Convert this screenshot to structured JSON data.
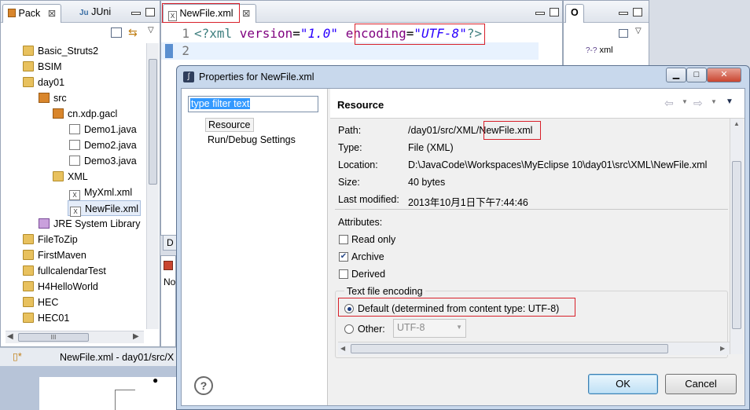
{
  "package_explorer": {
    "tabs": [
      {
        "label": "Pack"
      },
      {
        "label": "JUni"
      }
    ],
    "tree": [
      {
        "label": "Basic_Struts2",
        "icon": "project"
      },
      {
        "label": "BSIM",
        "icon": "project"
      },
      {
        "label": "day01",
        "icon": "project"
      },
      {
        "label": "src",
        "icon": "source-folder"
      },
      {
        "label": "cn.xdp.gacl",
        "icon": "package"
      },
      {
        "label": "Demo1.java",
        "icon": "java-file"
      },
      {
        "label": "Demo2.java",
        "icon": "java-file"
      },
      {
        "label": "Demo3.java",
        "icon": "java-file"
      },
      {
        "label": "XML",
        "icon": "folder"
      },
      {
        "label": "MyXml.xml",
        "icon": "xml-file"
      },
      {
        "label": "NewFile.xml",
        "icon": "xml-file"
      },
      {
        "label": "JRE System Library",
        "icon": "library"
      },
      {
        "label": "FileToZip",
        "icon": "project"
      },
      {
        "label": "FirstMaven",
        "icon": "project"
      },
      {
        "label": "fullcalendarTest",
        "icon": "project"
      },
      {
        "label": "H4HelloWorld",
        "icon": "project"
      },
      {
        "label": "HEC",
        "icon": "project"
      },
      {
        "label": "HEC01",
        "icon": "project"
      }
    ],
    "hscroll_label": "III"
  },
  "status_bar": {
    "text": "NewFile.xml - day01/src/X"
  },
  "editor": {
    "tab_label": "NewFile.xml",
    "lines": [
      {
        "num": "1",
        "pi_open": "<?xml ",
        "attr1": "version",
        "eq": "=",
        "val1": "\"1.0\"",
        "sp": " ",
        "attr2": "encoding",
        "val2": "\"UTF-8\"",
        "pi_close": "?>"
      },
      {
        "num": "2"
      }
    ],
    "side_tabs": [
      {
        "label": "D"
      },
      {
        "label": "No"
      }
    ]
  },
  "outline": {
    "tab_label": "O",
    "item_label": "xml",
    "item_icon": "?-?"
  },
  "dialog": {
    "title": "Properties for NewFile.xml",
    "filter_text": "type filter text",
    "nav": [
      {
        "label": "Resource"
      },
      {
        "label": "Run/Debug Settings"
      }
    ],
    "section_title": "Resource",
    "properties": [
      {
        "label": "Path:",
        "value_prefix": "/day01/src/XML/",
        "value_highlight": "NewFile.xml"
      },
      {
        "label": "Type:",
        "value": "File  (XML)"
      },
      {
        "label": "Location:",
        "value": "D:\\JavaCode\\Workspaces\\MyEclipse 10\\day01\\src\\XML\\NewFile.xml"
      },
      {
        "label": "Size:",
        "value": "40  bytes"
      },
      {
        "label": "Last modified:",
        "value": "2013年10月1日下午7:44:46"
      }
    ],
    "attributes_label": "Attributes:",
    "attributes": [
      {
        "label": "Read only",
        "checked": false
      },
      {
        "label": "Archive",
        "checked": true
      },
      {
        "label": "Derived",
        "checked": false
      }
    ],
    "encoding_group_label": "Text file encoding",
    "encoding_default_label": "Default (determined from content type: UTF-8)",
    "encoding_other_label": "Other:",
    "encoding_other_value": "UTF-8",
    "ok_label": "OK",
    "cancel_label": "Cancel",
    "help_label": "?",
    "colors": {
      "highlight_box": "#d8202a",
      "xml_tag": "#3f7f7f",
      "xml_attr": "#7f007f",
      "xml_value": "#2a00ff"
    }
  }
}
